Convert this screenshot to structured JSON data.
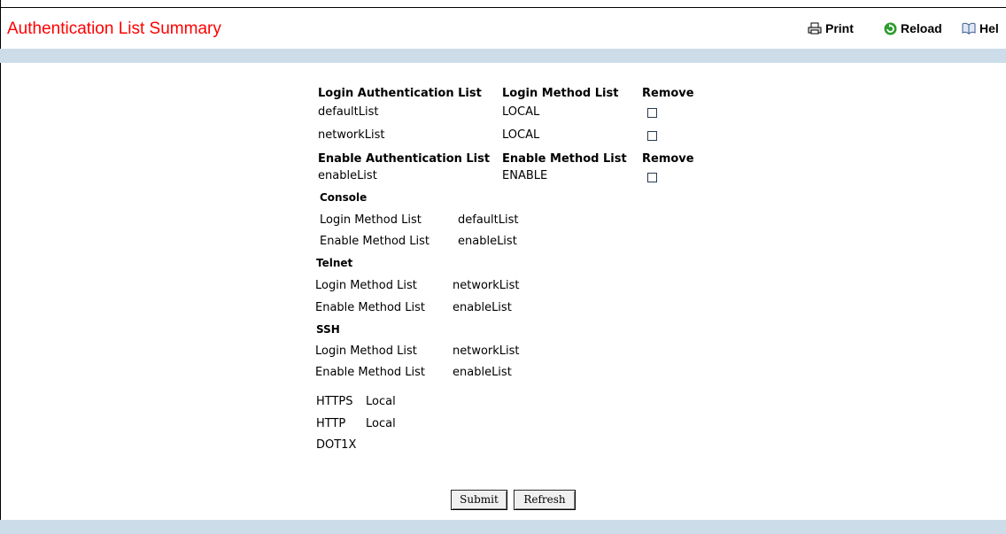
{
  "header": {
    "title": "Authentication List Summary",
    "print_label": "Print",
    "reload_label": "Reload",
    "help_label": "Hel"
  },
  "login_table": {
    "headers": [
      "Login Authentication List",
      "Login Method List",
      "Remove"
    ],
    "rows": [
      {
        "list": "defaultList",
        "method": "LOCAL"
      },
      {
        "list": "networkList",
        "method": "LOCAL"
      }
    ]
  },
  "enable_table": {
    "headers": [
      "Enable Authentication List",
      "Enable Method List",
      "Remove"
    ],
    "rows": [
      {
        "list": "enableList",
        "method": "ENABLE"
      }
    ]
  },
  "console": {
    "title": "Console",
    "login_label": "Login Method List",
    "login_value": "defaultList",
    "enable_label": "Enable Method List",
    "enable_value": "enableList"
  },
  "telnet": {
    "title": "Telnet",
    "login_label": "Login Method List",
    "login_value": "networkList",
    "enable_label": "Enable Method List",
    "enable_value": "enableList"
  },
  "ssh": {
    "title": "SSH",
    "login_label": "Login Method List",
    "login_value": "networkList",
    "enable_label": "Enable Method List",
    "enable_value": "enableList"
  },
  "other": {
    "https_label": "HTTPS",
    "https_value": "Local",
    "http_label": "HTTP",
    "http_value": "Local",
    "dot1x_label": "DOT1X"
  },
  "buttons": {
    "submit": "Submit",
    "refresh": "Refresh"
  }
}
